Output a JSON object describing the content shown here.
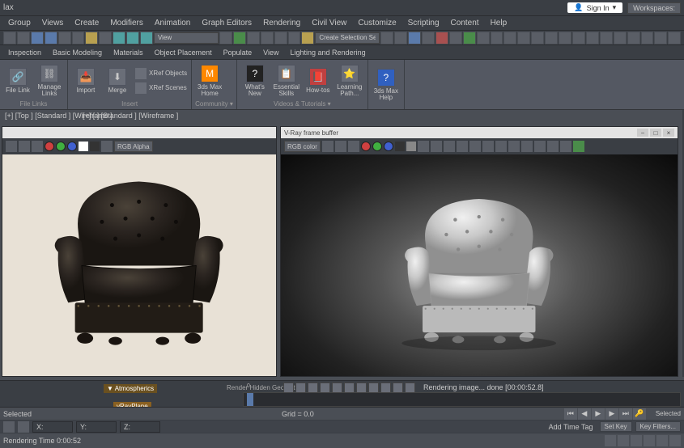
{
  "titlebar": {
    "app_prefix": "lax",
    "signin": "Sign In",
    "workspaces": "Workspaces:"
  },
  "menubar": {
    "items": [
      "Group",
      "Views",
      "Create",
      "Modifiers",
      "Animation",
      "Graph Editors",
      "Rendering",
      "Civil View",
      "Customize",
      "Scripting",
      "Content",
      "Help"
    ]
  },
  "qat": {
    "selection_filter": "Create Selection Se"
  },
  "ribbontabs": {
    "items": [
      "Inspection",
      "Basic Modeling",
      "Materials",
      "Object Placement",
      "Populate",
      "View",
      "Lighting and Rendering"
    ]
  },
  "ribbon": {
    "groups": [
      {
        "label": "File Links",
        "buttons": [
          {
            "label": "File Link",
            "icon": "🔗"
          },
          {
            "label": "Manage Links",
            "icon": "⛓"
          }
        ]
      },
      {
        "label": "Insert",
        "buttons": [
          {
            "label": "Import",
            "icon": "📥"
          },
          {
            "label": "Merge",
            "icon": "⬇"
          }
        ],
        "small": [
          {
            "label": "XRef Objects"
          },
          {
            "label": "XRef Scenes"
          }
        ]
      },
      {
        "label": "Community ▾",
        "buttons": [
          {
            "label": "3ds Max Home",
            "icon": "🏠"
          }
        ]
      },
      {
        "label": "Videos & Tutorials ▾",
        "buttons": [
          {
            "label": "What's New",
            "icon": "❓"
          },
          {
            "label": "Essential Skills",
            "icon": "📋"
          },
          {
            "label": "How-tos",
            "icon": "📕"
          },
          {
            "label": "Learning Path...",
            "icon": "⭐"
          }
        ]
      },
      {
        "label": "",
        "buttons": [
          {
            "label": "3ds Max Help",
            "icon": "?"
          }
        ]
      }
    ]
  },
  "viewport": {
    "label1": "[+] [Top ] [Standard ] [Wireframe ]",
    "label2": "[+] [ ] [Standard ] [Wireframe ]"
  },
  "win_left": {
    "title": "",
    "rgb_mode": "RGB Alpha"
  },
  "win_right": {
    "title": "V-Ray frame buffer",
    "rgb_mode": "RGB color"
  },
  "render_bar": {
    "status": "Rendering image... done [00:00:52.8]"
  },
  "trackview": {
    "label1": "▼ Atmospherics",
    "label2": "vRayPlane",
    "tick_start": "0",
    "render_hidden": "Render Hidden Geometry"
  },
  "statusbar": {
    "selected_top": "Selected",
    "coords": {
      "x": "X:",
      "y": "Y:",
      "z": "Z:"
    },
    "grid": "Grid = 0.0",
    "selected_bot": "Selected",
    "time_tag": "Add Time Tag",
    "rendering_time": "Rendering Time 0:00:52",
    "set_key": "Set Key",
    "key_filters": "Key Filters...",
    "auto_key": "",
    "frame": "0"
  }
}
